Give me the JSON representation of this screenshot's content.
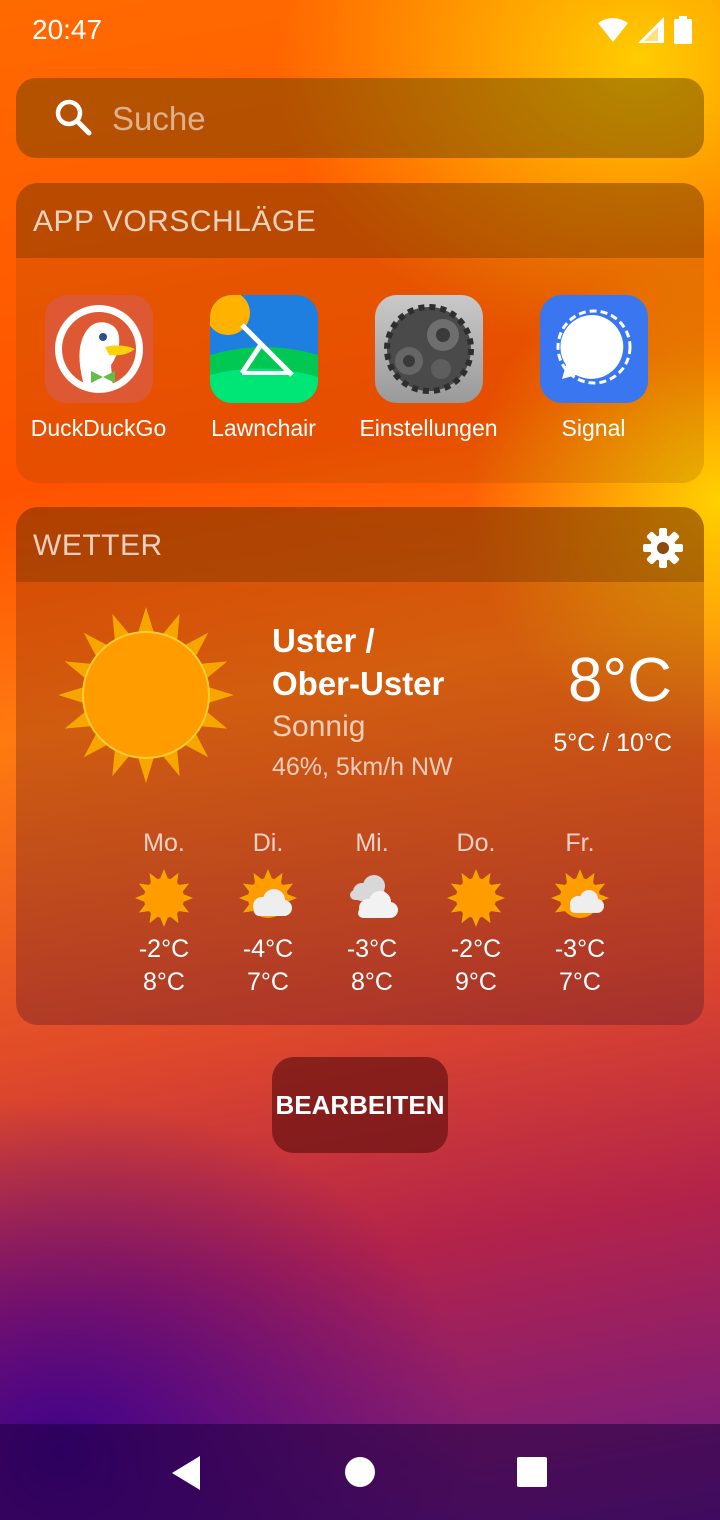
{
  "status": {
    "time": "20:47"
  },
  "search": {
    "placeholder": "Suche"
  },
  "apps_section": {
    "title": "APP VORSCHLÄGE",
    "items": [
      {
        "label": "DuckDuckGo",
        "icon": "duckduckgo-icon"
      },
      {
        "label": "Lawnchair",
        "icon": "lawnchair-icon"
      },
      {
        "label": "Einstellungen",
        "icon": "settings-icon"
      },
      {
        "label": "Signal",
        "icon": "signal-icon"
      }
    ]
  },
  "weather": {
    "title": "WETTER",
    "location_line1": "Uster /",
    "location_line2": "Ober-Uster",
    "condition": "Sonnig",
    "details": "46%, 5km/h NW",
    "temperature": "8°C",
    "range": "5°C / 10°C",
    "forecast": [
      {
        "day": "Mo.",
        "low": "-2°C",
        "high": "8°C",
        "icon": "sunny"
      },
      {
        "day": "Di.",
        "low": "-4°C",
        "high": "7°C",
        "icon": "partly-cloudy"
      },
      {
        "day": "Mi.",
        "low": "-3°C",
        "high": "8°C",
        "icon": "cloudy"
      },
      {
        "day": "Do.",
        "low": "-2°C",
        "high": "9°C",
        "icon": "sunny"
      },
      {
        "day": "Fr.",
        "low": "-3°C",
        "high": "7°C",
        "icon": "partly-cloudy"
      }
    ]
  },
  "edit_button": {
    "label": "BEARBEITEN"
  },
  "colors": {
    "accent_orange": "#ff6a00",
    "sun": "#ff9d00",
    "signal_blue": "#3a76f0"
  }
}
